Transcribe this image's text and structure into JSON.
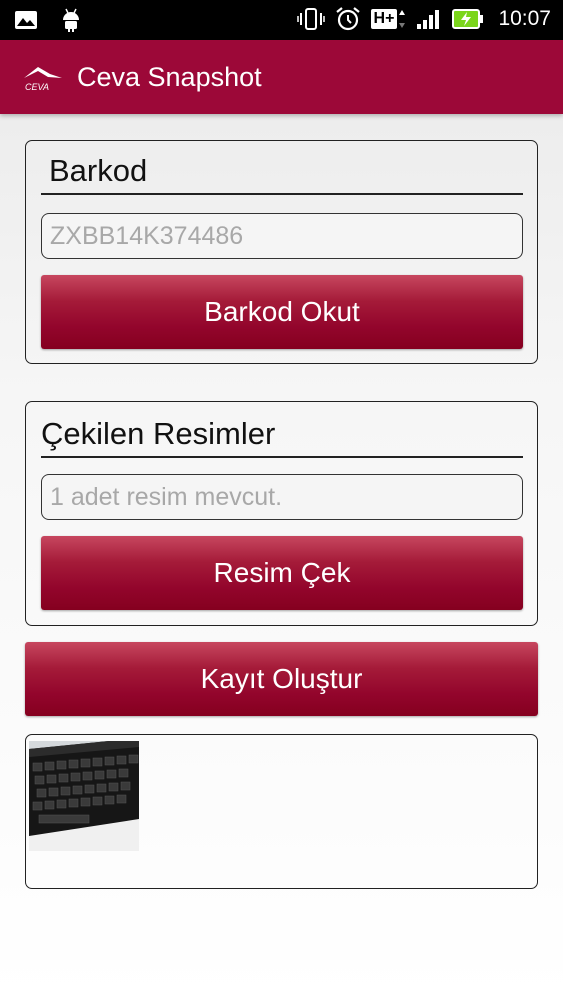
{
  "status_bar": {
    "time": "10:07",
    "left_icons": [
      "image-icon",
      "android-icon"
    ],
    "right_icons": [
      "vibrate-icon",
      "alarm-icon",
      "hplus-network-icon",
      "signal-icon",
      "battery-charging-icon"
    ],
    "network_label": "H+"
  },
  "app_bar": {
    "logo_text": "CEVA",
    "title": "Ceva Snapshot"
  },
  "barcode_section": {
    "heading": "Barkod",
    "field_placeholder": "ZXBB14K374486",
    "scan_button": "Barkod Okut"
  },
  "images_section": {
    "heading": "Çekilen Resimler",
    "field_placeholder": "1 adet resim mevcut.",
    "capture_button": "Resim Çek"
  },
  "create_button": "Kayıt Oluştur",
  "photos": {
    "items": [
      {
        "icon": "keyboard-photo-thumbnail"
      }
    ]
  },
  "colors": {
    "brand": "#9c0838",
    "button": "#9a0a31",
    "status_bar": "#000000"
  }
}
